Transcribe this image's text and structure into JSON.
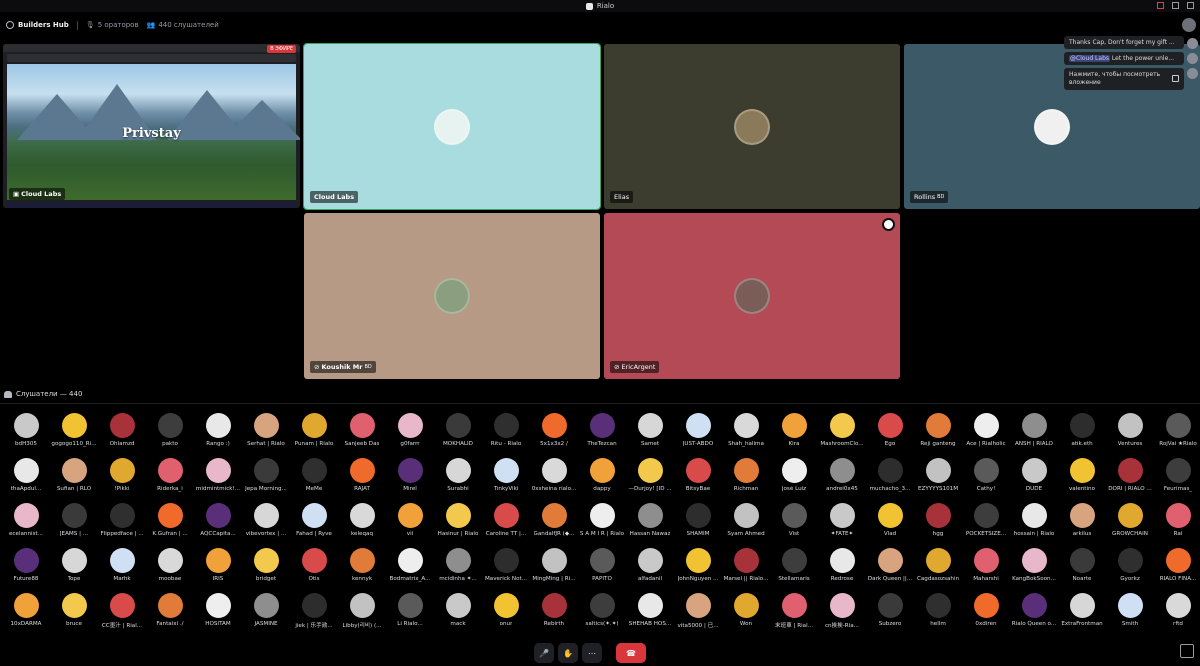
{
  "app": {
    "title": "Rialo"
  },
  "header": {
    "title": "Builders Hub",
    "speakers": "5 ораторов",
    "listeners": "440 слушателей"
  },
  "stage": {
    "screen_share": {
      "live_badge": "В ЭФИРЕ",
      "brand": "Privstay",
      "owner": "Cloud Labs"
    },
    "tiles": [
      {
        "name": "Cloud Labs",
        "tag": "",
        "color": "#a9dcdf",
        "avatar": "#e6f3f0"
      },
      {
        "name": "Elias",
        "tag": "",
        "color": "#3d3d2f",
        "avatar": "#8a7a5a"
      },
      {
        "name": "Rollins",
        "tag": "BD",
        "color": "#3c5967",
        "avatar": "#f0f0f0"
      },
      {
        "name": "Koushik Mr",
        "tag": "BD",
        "color": "#b69a86",
        "avatar": "#8b9f80"
      },
      {
        "name": "EricArgent",
        "tag": "",
        "color": "#b44a55",
        "avatar": "#7b5d58"
      }
    ]
  },
  "chat": {
    "messages": [
      {
        "text": "Thanks Cap, Don't forget my gift ..."
      },
      {
        "mention": "@Cloud Labs",
        "text": " Let the power unle..."
      },
      {
        "text": "Нажмите, чтобы посмотреть вложение"
      }
    ]
  },
  "audience": {
    "header": "Слушатели — 440",
    "rows": [
      [
        "bdH305",
        "gogogo110_Ri...",
        "Ohlamzd",
        "pakto",
        "Rango :)",
        "Serhat | Rialo",
        "Punam | Rialo",
        "Sanjeeb Das",
        "g0farrr",
        "MOKHALID",
        "Ritu - Rialo",
        "5x1x3x2 /",
        "TheTezcan",
        "Samet",
        "JUST-ABDO",
        "Shah_halima",
        "Kira",
        "MashroomClo...",
        "Ego",
        "Reji ganteng",
        "Ace | Rialholic",
        "ANSH | RIALO",
        "atik.eth",
        "Ventures",
        "RojVai ★Rialo"
      ],
      [
        "thaApdul...",
        "Sufian | RLO",
        "!Pikki",
        "Riderka_i",
        "midmintmick!...",
        "Jepa Morning...",
        "MeMe",
        "RAJAT",
        "Mirel",
        "Surabhi",
        "TinkyViki",
        "0xsheina rialo...",
        "dappy",
        "—Durjoy! [ID ...",
        "BitsyBae",
        "Richman",
        "José Luiz",
        "andrei0x45",
        "muchacho_3...",
        "EZYYYYS101M",
        "Cathy!",
        "DUDE",
        "valentino",
        "DORI | RIALO ...",
        "Feurimas_"
      ],
      [
        "ecelannist...",
        "JEAMS | ...",
        "Flippedface | ...",
        "K.Gufran | ...",
        "AQCCapita...",
        "vibevortex | ...",
        "Fahad | Ryve",
        "keleqaq",
        "vii",
        "Hasinur | Rialo",
        "Caroline TT |...",
        "GandalfJR (◆...",
        "S A M I R | Rialo",
        "Hassan Nawaz",
        "SHAMIM",
        "Syam Ahmed",
        "Vist",
        "✦FATE✦",
        "Vlad",
        "hgg",
        "POCKETSIZE...",
        "hossain | Rialo",
        "arkilus",
        "GROWCHAIN",
        "Rai"
      ],
      [
        "Future88",
        "Tope",
        "Marhk",
        "moobae",
        "IRIS",
        "bridget",
        "Otis",
        "kennyk",
        "Bodmatrix_A...",
        "mcidinha ✦...",
        "Maverick Not...",
        "MingMing | Ri...",
        "PAPITO",
        "alfadanil",
        "JohnNguyen ...",
        "Marsel || Rialo...",
        "Stellamaris",
        "Redrose",
        "Dark Queen ||...",
        "Cagdasozsahin",
        "Maharshi",
        "KangBokSoon...",
        "Noarte",
        "Gyorkz",
        "RIALO FINA..."
      ],
      [
        "10xDARMA",
        "bruce",
        "CC墨汁 | Rial...",
        "Fantaixi ./",
        "HOSITAM",
        "JASMINE",
        "jiek | 乐手勋...",
        "Libby(리비) (...",
        "Li Rialo...",
        "mack",
        "onur",
        "Rebirth",
        "saltics(✦.✦)",
        "SHEHAB HOS...",
        "vita5000 | 已...",
        "Won",
        "末班車 | Rial...",
        "cn挨挨-Ria...",
        "Subzero",
        "hellm",
        "0xdiren",
        "Rialo Queen o...",
        "ExtraFrontman",
        "Smith",
        "rftd"
      ]
    ]
  },
  "controls": {
    "mute": "🎤",
    "raise_hand": "✋",
    "more": "⋯",
    "leave": "☎"
  }
}
